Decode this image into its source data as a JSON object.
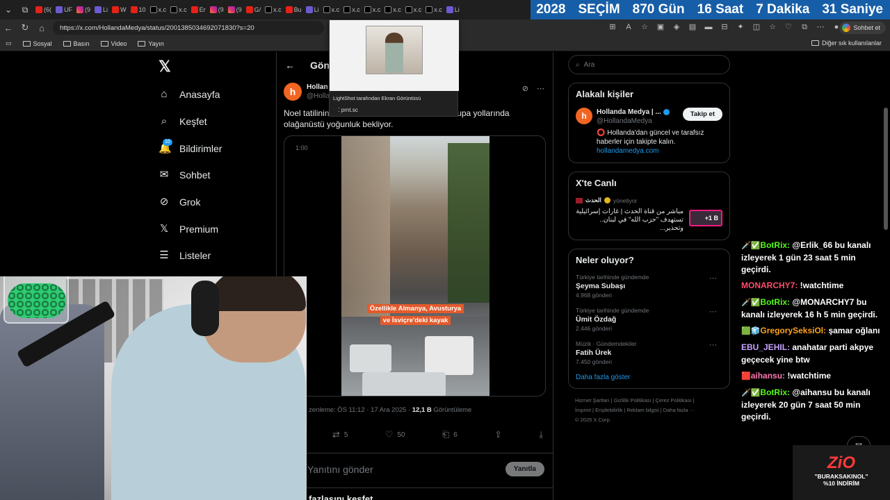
{
  "browser": {
    "tabs": [
      {
        "icon": "yt",
        "label": "(6("
      },
      {
        "icon": "pen",
        "label": "UF"
      },
      {
        "icon": "ig",
        "label": "(9"
      },
      {
        "icon": "pen",
        "label": "Li"
      },
      {
        "icon": "yt",
        "label": "W"
      },
      {
        "icon": "yt",
        "label": "10"
      },
      {
        "icon": "x",
        "label": "x.c"
      },
      {
        "icon": "x",
        "label": "x.c"
      },
      {
        "icon": "yt",
        "label": "Er"
      },
      {
        "icon": "ig",
        "label": "(9"
      },
      {
        "icon": "ig",
        "label": "(9"
      },
      {
        "icon": "yt",
        "label": "G/"
      },
      {
        "icon": "x",
        "label": "x.c"
      },
      {
        "icon": "yt",
        "label": "Bu"
      },
      {
        "icon": "pen",
        "label": "Li"
      },
      {
        "icon": "x",
        "label": "x.c"
      },
      {
        "icon": "x",
        "label": "x.c"
      },
      {
        "icon": "x",
        "label": "x.c"
      },
      {
        "icon": "x",
        "label": "x.c"
      },
      {
        "icon": "x",
        "label": "x.c"
      },
      {
        "icon": "x",
        "label": "x.c"
      },
      {
        "icon": "pen",
        "label": "Li"
      }
    ],
    "countdown": {
      "year": "2028",
      "label": "SEÇİM",
      "days": "870 Gün",
      "hours": "16 Saat",
      "minutes": "7 Dakika",
      "seconds": "31 Saniye"
    },
    "url": "https://x.com/HollandaMedya/status/2001385034692071830?s=20",
    "profile_label": "Sohbet et",
    "bookmarks": [
      "Sosyal",
      "Basın",
      "Video",
      "Yayın"
    ],
    "other_bookmarks": "Diğer sık kullanılanlar"
  },
  "lightshot": {
    "title": "LightShot tarafından Ekran Görüntüsü",
    "url": "prnt.sc"
  },
  "sidebar": {
    "items": [
      {
        "icon": "home-icon",
        "label": "Anasayfa"
      },
      {
        "icon": "search-icon",
        "label": "Keşfet"
      },
      {
        "icon": "bell-icon",
        "label": "Bildirimler",
        "badge": "10"
      },
      {
        "icon": "mail-icon",
        "label": "Sohbet"
      },
      {
        "icon": "grok-icon",
        "label": "Grok"
      },
      {
        "icon": "x-icon",
        "label": "Premium"
      },
      {
        "icon": "list-icon",
        "label": "Listeler"
      }
    ]
  },
  "post": {
    "header_title": "Gön",
    "author_name": "Hollan",
    "author_handle": "@Holla",
    "text_line1": "Noel tatilinin",
    "text_line1_end": "e Avrupa yollarında",
    "text_line2": "olağanüstü yoğunluk bekliyor.",
    "video_time": "1:00",
    "caption_line1": "Özellikle Almanya, Avusturya",
    "caption_line2": "ve İsviçre'deki kayak",
    "meta_time": "zenleme: ÖS 11:12 · 17 Ara 2025 · ",
    "meta_views": "12,1 B",
    "meta_views_label": " Görüntüleme",
    "reposts": "5",
    "likes": "50",
    "bookmarks": "6",
    "reply_placeholder": "Yanıtını gönder",
    "reply_button": "Yanıtla",
    "discover_more": "fazlasını keşfet"
  },
  "right": {
    "search_placeholder": "Ara",
    "related_title": "Alakalı kişiler",
    "related_name": "Hollanda Medya | ...",
    "related_handle": "@HollandaMedya",
    "follow_label": "Takip et",
    "bio_mark": "⭕",
    "bio_text": " Hollanda'dan güncel ve tarafsız haberler için takipte kalın.",
    "bio_link": "hollandamedya.com",
    "live_title": "X'te Canlı",
    "live_source": "الحدث",
    "live_status": "yönetiyor",
    "live_text": "مباشر من قناة الحدث | غارات إسرائيلية تستهدف \"حزب الله\" في لبنان.. وتحذير...",
    "live_viewers": "+1 B",
    "trends_title": "Neler oluyor?",
    "trends": [
      {
        "context": "Türkiye tarihinde gündemde",
        "title": "Şeyma Subaşı",
        "count": "4.968 gönderi"
      },
      {
        "context": "Türkiye tarihinde gündemde",
        "title": "Ümit Özdağ",
        "count": "2.446 gönderi"
      },
      {
        "context": "Müzik · Gündemdekiler",
        "title": "Fatih Ürek",
        "count": "7.450 gönderi"
      }
    ],
    "show_more": "Daha fazla göster",
    "footer_line1": "Hizmet Şartları  |  Gizlilik Politikası  |  Çerez Politikası  |",
    "footer_line2": "İmprint  |  Erişilebilirlik  |  Reklam bilgisi  |  Daha fazla ···",
    "footer_line3": "© 2025 X Corp."
  },
  "chat": [
    {
      "badges": "🗡️✅",
      "user": "BotRix:",
      "user_class": "bot",
      "text": " @Erlik_66 bu kanalı izleyerek 1 gün 23 saat 5 min geçirdi."
    },
    {
      "badges": "",
      "user": "MONARCHY7:",
      "user_class": "u-red",
      "text": " !watchtime"
    },
    {
      "badges": "🗡️✅",
      "user": "BotRix:",
      "user_class": "bot",
      "text": " @MONARCHY7 bu kanalı izleyerek 16 h 5 min geçirdi."
    },
    {
      "badges": "🟩🧊",
      "user": "GregorySeksiOl:",
      "user_class": "u-orange",
      "text": " şamar oğlanı"
    },
    {
      "badges": "",
      "user": "EBU_JEHIL:",
      "user_class": "u-purple",
      "text": " anahatar parti akpye geçecek yine btw"
    },
    {
      "badges": "🟥",
      "user": "aihansu:",
      "user_class": "u-pink",
      "text": " !watchtime"
    },
    {
      "badges": "🗡️✅",
      "user": "BotRix:",
      "user_class": "bot",
      "text": " @aihansu bu kanalı izleyerek 20 gün 7 saat 50 min geçirdi."
    }
  ],
  "promo": {
    "logo": "ZiO",
    "line1": "\"BURAKSAKINOL\"",
    "line2": "%10 İNDİRİM"
  }
}
